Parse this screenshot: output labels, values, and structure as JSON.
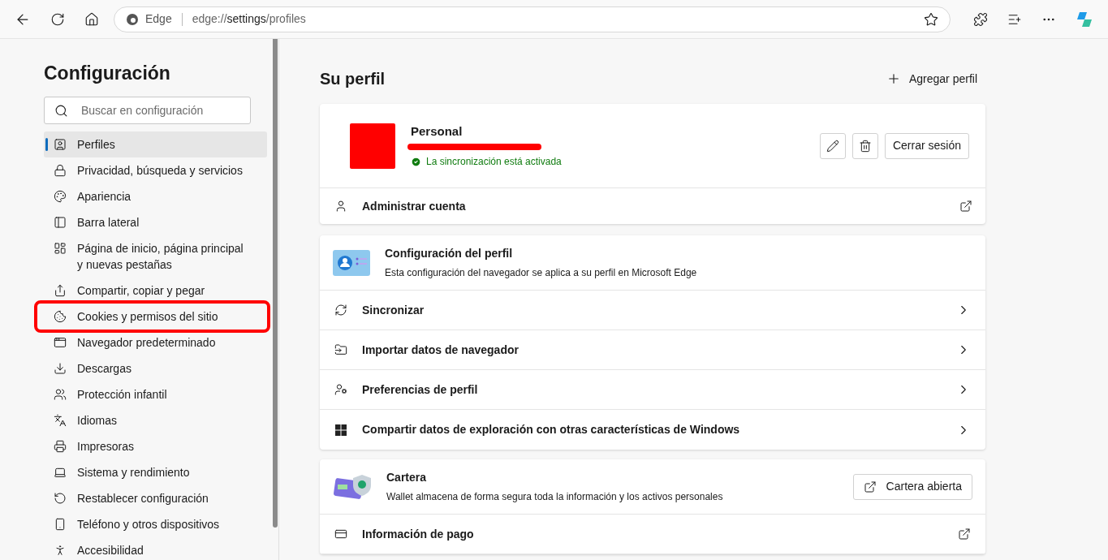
{
  "toolbar": {
    "site_label": "Edge",
    "url": "edge://**settings**/profiles"
  },
  "sidebar": {
    "title": "Configuración",
    "search": {
      "placeholder": "Buscar en configuración"
    },
    "items": [
      {
        "label": "Perfiles",
        "selected": true,
        "highlighted": false
      },
      {
        "label": "Privacidad, búsqueda y servicios",
        "selected": false,
        "highlighted": false
      },
      {
        "label": "Apariencia",
        "selected": false,
        "highlighted": false
      },
      {
        "label": "Barra lateral",
        "selected": false,
        "highlighted": false
      },
      {
        "label": "Página de inicio, página principal y nuevas pestañas",
        "selected": false,
        "highlighted": false
      },
      {
        "label": "Compartir, copiar y pegar",
        "selected": false,
        "highlighted": false
      },
      {
        "label": "Cookies y permisos del sitio",
        "selected": false,
        "highlighted": true
      },
      {
        "label": "Navegador predeterminado",
        "selected": false,
        "highlighted": false
      },
      {
        "label": "Descargas",
        "selected": false,
        "highlighted": false
      },
      {
        "label": "Protección infantil",
        "selected": false,
        "highlighted": false
      },
      {
        "label": "Idiomas",
        "selected": false,
        "highlighted": false
      },
      {
        "label": "Impresoras",
        "selected": false,
        "highlighted": false
      },
      {
        "label": "Sistema y rendimiento",
        "selected": false,
        "highlighted": false
      },
      {
        "label": "Restablecer configuración",
        "selected": false,
        "highlighted": false
      },
      {
        "label": "Teléfono y otros dispositivos",
        "selected": false,
        "highlighted": false
      },
      {
        "label": "Accesibilidad",
        "selected": false,
        "highlighted": false
      }
    ]
  },
  "main": {
    "heading": "Su perfil",
    "add_profile": "Agregar perfil",
    "profile": {
      "name": "Personal",
      "sync_status": "La sincronización está activada",
      "sign_out": "Cerrar sesión",
      "manage": "Administrar cuenta"
    },
    "settings_card": {
      "title": "Configuración del perfil",
      "subtitle": "Esta configuración del navegador se aplica a su perfil en Microsoft Edge",
      "rows": [
        "Sincronizar",
        "Importar datos de navegador",
        "Preferencias de perfil",
        "Compartir datos de exploración con otras características de Windows"
      ]
    },
    "wallet": {
      "title": "Cartera",
      "subtitle": "Wallet almacena de forma segura toda la información y los activos personales",
      "button": "Cartera abierta",
      "rows": [
        "Información de pago"
      ]
    }
  }
}
